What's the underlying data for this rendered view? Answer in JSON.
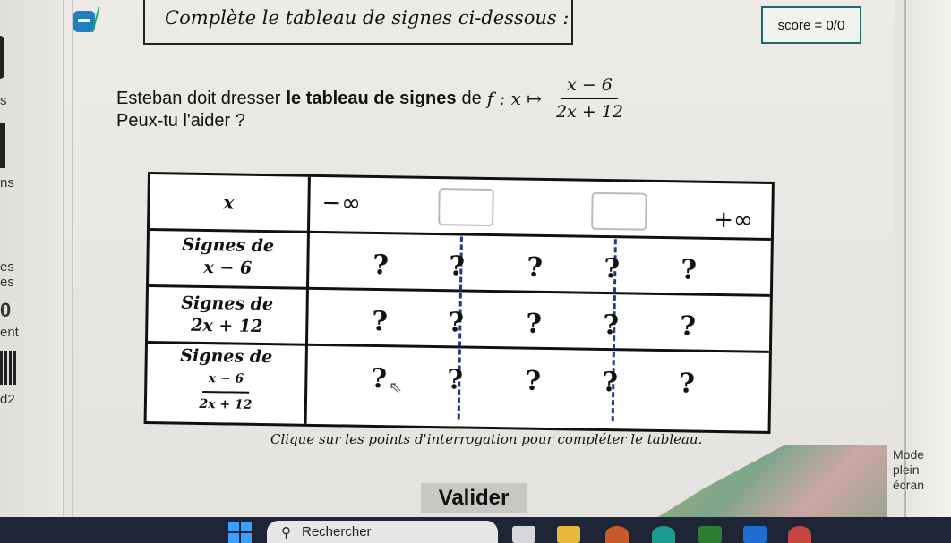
{
  "header": {
    "instruction": "Complète le tableau de signes ci-dessous :",
    "score_label": "score = 0/0"
  },
  "intro": {
    "line1_prefix": "Esteban doit dresser",
    "line1_bold": "le tableau de signes",
    "line1_suffix": "de",
    "function_def": "f : x ↦",
    "numerator": "x − 6",
    "denominator": "2x + 12",
    "line2": "Peux-tu l'aider ?"
  },
  "table": {
    "x_header": "x",
    "minus_infinity": "−∞",
    "plus_infinity": "+∞",
    "rows": [
      {
        "label_title": "Signes de",
        "label_expr": "x − 6",
        "cells": [
          "?",
          "?",
          "?",
          "?",
          "?"
        ]
      },
      {
        "label_title": "Signes de",
        "label_expr": "2x + 12",
        "cells": [
          "?",
          "?",
          "?",
          "?",
          "?"
        ]
      },
      {
        "label_title": "Signes de",
        "label_num": "x − 6",
        "label_den": "2x + 12",
        "cells": [
          "?",
          "?",
          "?",
          "?",
          "?"
        ]
      }
    ]
  },
  "hint": "Clique sur les points d'interrogation pour compléter le tableau.",
  "validate_label": "Valider",
  "mode": {
    "line1": "Mode",
    "line2": "plein",
    "line3": "écran"
  },
  "sidebar_fragments": [
    "s",
    "ns",
    "es",
    "es",
    "0",
    "ent",
    "d2"
  ],
  "taskbar": {
    "search_placeholder": "Rechercher"
  },
  "colors": {
    "score_border": "#1d6b6b",
    "dash": "#1a3c8c",
    "taskbar": "#1d2536",
    "accent": "#1e7fc3"
  }
}
